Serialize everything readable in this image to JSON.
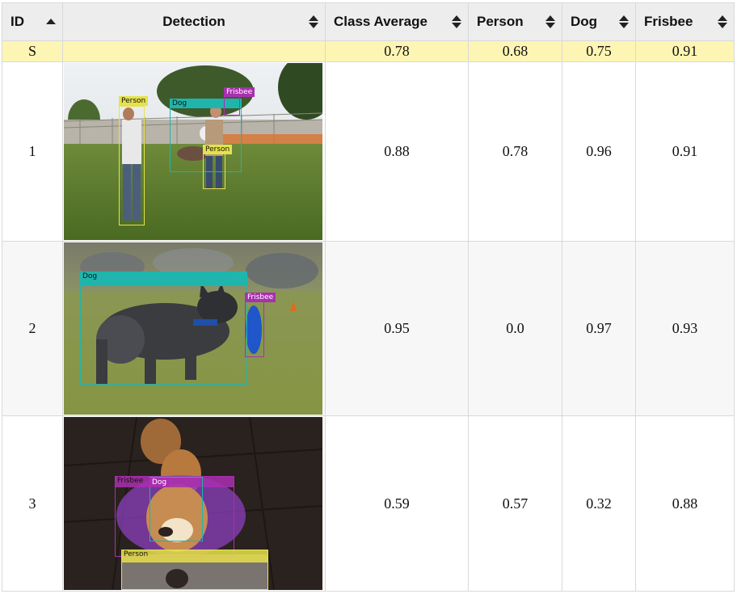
{
  "columns": {
    "id": "ID",
    "detection": "Detection",
    "class_average": "Class Average",
    "person": "Person",
    "dog": "Dog",
    "frisbee": "Frisbee"
  },
  "sort": {
    "column": "ID",
    "direction": "ascending"
  },
  "summary": {
    "id": "S",
    "class_average": "0.78",
    "person": "0.68",
    "dog": "0.75",
    "frisbee": "0.91"
  },
  "rows": [
    {
      "id": "1",
      "class_average": "0.88",
      "person": "0.78",
      "dog": "0.96",
      "frisbee": "0.91",
      "labels": {
        "person_a": "Person",
        "dog": "Dog",
        "frisbee": "Frisbee",
        "person_b": "Person"
      }
    },
    {
      "id": "2",
      "class_average": "0.95",
      "person": "0.0",
      "dog": "0.97",
      "frisbee": "0.93",
      "labels": {
        "dog": "Dog",
        "frisbee": "Frisbee"
      }
    },
    {
      "id": "3",
      "class_average": "0.59",
      "person": "0.57",
      "dog": "0.32",
      "frisbee": "0.88",
      "labels": {
        "frisbee": "Frisbee",
        "dog": "Dog",
        "person": "Person"
      }
    }
  ],
  "colors": {
    "person": "#e6e24a",
    "dog": "#1fb5ad",
    "frisbee": "#a92fb0",
    "summary_row": "#fdf5b4",
    "header_bg": "#ededed"
  }
}
